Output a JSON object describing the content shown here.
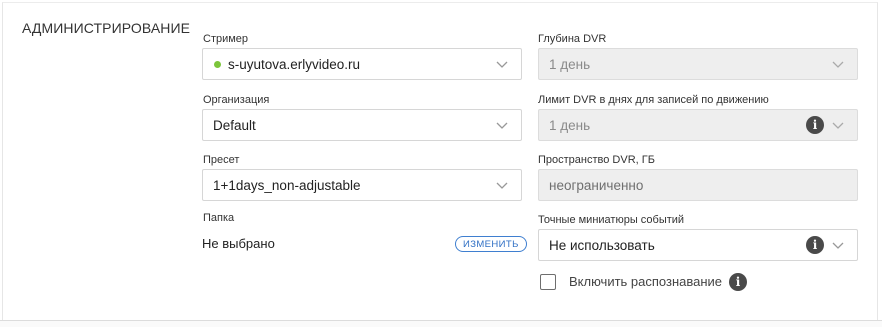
{
  "section": {
    "title": "АДМИНИСТРИРОВАНИЕ"
  },
  "streamer": {
    "label": "Стример",
    "value": "s-uyutova.erlyvideo.ru",
    "status_color": "#7cc53b"
  },
  "organization": {
    "label": "Организация",
    "value": "Default"
  },
  "preset": {
    "label": "Пресет",
    "value": "1+1days_non-adjustable"
  },
  "folder": {
    "label": "Папка",
    "value": "Не выбрано",
    "change_label": "ИЗМЕНИТЬ"
  },
  "dvr_depth": {
    "label": "Глубина DVR",
    "value": "1 день"
  },
  "dvr_motion_limit": {
    "label": "Лимит DVR в днях для записей по движению",
    "value": "1 день"
  },
  "dvr_space": {
    "label": "Пространство DVR, ГБ",
    "value": "неограниченно"
  },
  "event_thumbnails": {
    "label": "Точные миниатюры событий",
    "value": "Не использовать"
  },
  "recognition": {
    "label": "Включить распознавание",
    "checked": false
  },
  "icons": {
    "info": "info-icon",
    "chevron": "chevron-down-icon"
  }
}
